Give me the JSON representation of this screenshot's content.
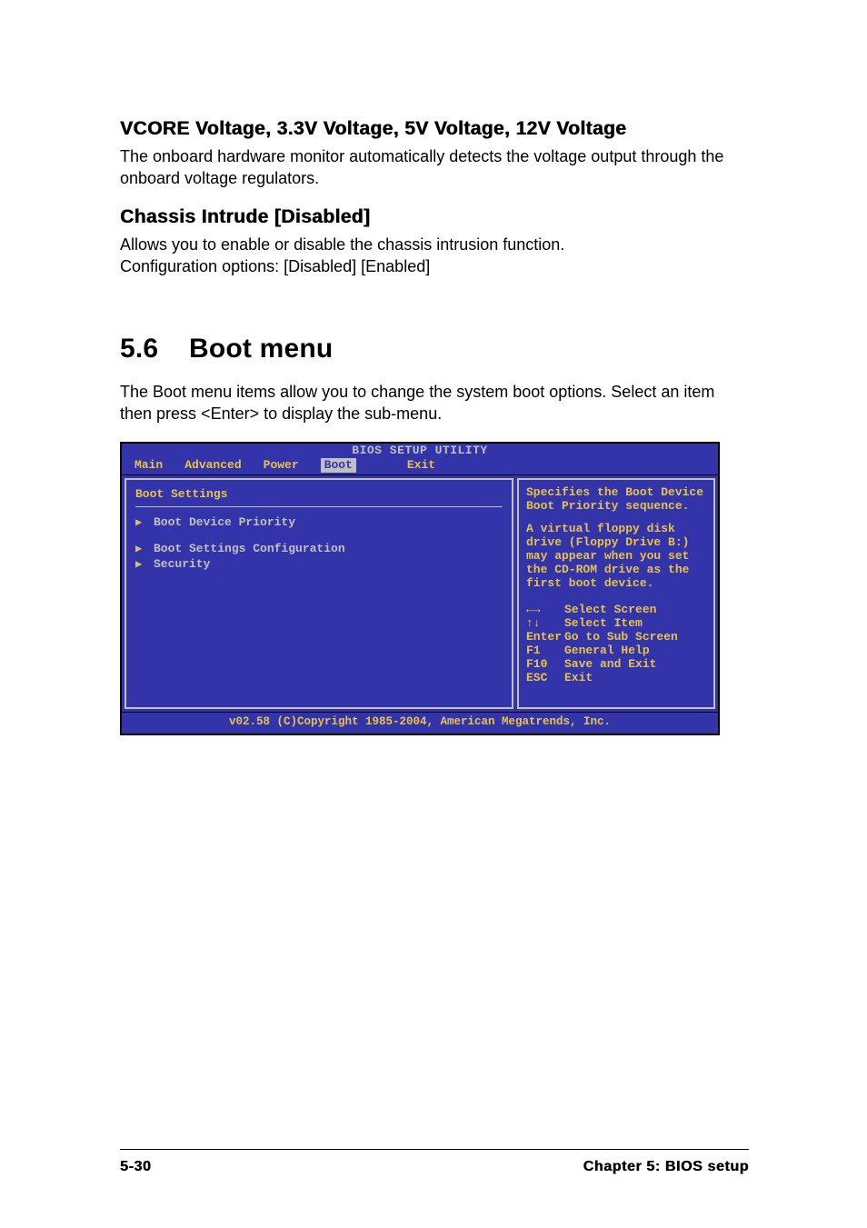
{
  "section1": {
    "heading": "VCORE Voltage, 3.3V Voltage, 5V Voltage, 12V Voltage",
    "text": "The onboard hardware monitor automatically detects the voltage output through the onboard voltage regulators."
  },
  "section2": {
    "heading": "Chassis Intrude [Disabled]",
    "text1": "Allows you to enable or disable the chassis intrusion function.",
    "text2": "Configuration options: [Disabled] [Enabled]"
  },
  "boot_heading": {
    "num": "5.6",
    "title": "Boot menu"
  },
  "boot_text": "The Boot menu items allow you to change the system boot options. Select an item then press <Enter> to display the sub-menu.",
  "bios": {
    "title": "BIOS SETUP UTILITY",
    "tabs": [
      "Main",
      "Advanced",
      "Power",
      "Boot",
      "Exit"
    ],
    "active_tab": "Boot",
    "left_title": "Boot Settings",
    "items": [
      "Boot Device Priority",
      "Boot Settings Configuration",
      "Security"
    ],
    "help1": "Specifies the Boot Device Boot Priority sequence.",
    "help2": "A virtual floppy disk drive (Floppy Drive B:) may appear when you set the CD-ROM drive as the first boot device.",
    "nav": [
      {
        "key": "←→",
        "label": "Select Screen"
      },
      {
        "key": "↑↓",
        "label": "Select Item"
      },
      {
        "key": "Enter",
        "label": "Go to Sub Screen"
      },
      {
        "key": "F1",
        "label": "General Help"
      },
      {
        "key": "F10",
        "label": "Save and Exit"
      },
      {
        "key": "ESC",
        "label": "Exit"
      }
    ],
    "footer": "v02.58 (C)Copyright 1985-2004, American Megatrends, Inc."
  },
  "footer": {
    "left": "5-30",
    "right": "Chapter 5: BIOS setup"
  }
}
